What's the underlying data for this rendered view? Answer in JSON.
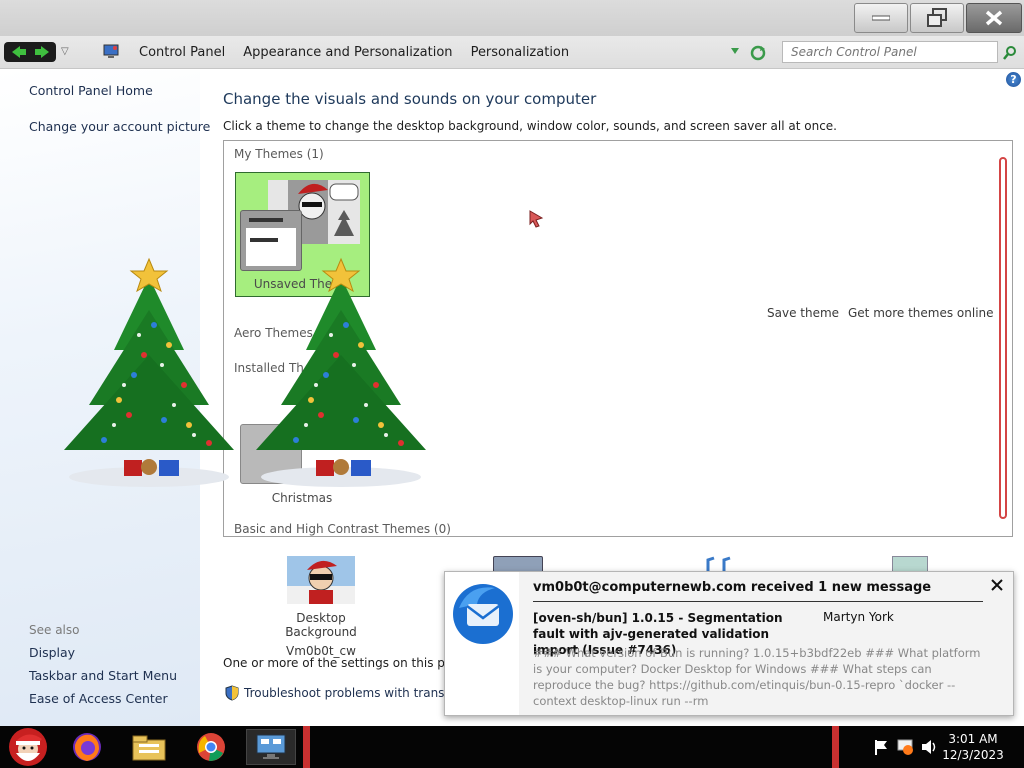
{
  "window": {
    "minimize_label": "minimize",
    "maximize_label": "restore",
    "close_label": "close"
  },
  "address": {
    "crumbs": [
      "Control Panel",
      "Appearance and Personalization",
      "Personalization"
    ],
    "search_placeholder": "Search Control Panel"
  },
  "sidebar": {
    "top_links": [
      "Control Panel Home",
      "Change your account picture"
    ],
    "see_also_label": "See also",
    "see_also_links": [
      "Display",
      "Taskbar and Start Menu",
      "Ease of Access Center"
    ]
  },
  "main": {
    "title": "Change the visuals and sounds on your computer",
    "subtitle": "Click a theme to change the desktop background, window color, sounds, and screen saver all at once.",
    "groups": {
      "my_themes": "My Themes (1)",
      "aero_themes": "Aero Themes",
      "installed_themes": "Installed Th",
      "basic_themes": "Basic and High Contrast Themes (0)"
    },
    "unsaved_theme_label": "Unsaved Theme",
    "christmas_label": "Christmas",
    "save_theme": "Save theme",
    "get_more_themes": "Get more themes online",
    "desktop_background_label": "Desktop Background",
    "desktop_background_value": "Vm0b0t_cw",
    "bottom_note": "One or more of the settings on this page h",
    "troubleshoot_link": "Troubleshoot problems with transpare"
  },
  "notification": {
    "title": "vm0b0t@computernewb.com received 1 new message",
    "subject": "[oven-sh/bun] 1.0.15 - Segmentation fault with ajv-generated validation import (Issue #7436)",
    "sender": "Martyn York",
    "body": "### What version of Bun is running? 1.0.15+b3bdf22eb ### What platform is your computer? Docker Desktop for Windows ### What steps can reproduce the bug? https://github.com/etinquis/bun-0.15-repro `docker --context desktop-linux run --rm"
  },
  "taskbar": {
    "time": "3:01 AM",
    "date": "12/3/2023"
  },
  "icons": {
    "help": "?",
    "apps": [
      "santa-start-icon",
      "firefox-icon",
      "file-explorer-icon",
      "chrome-icon",
      "control-panel-icon"
    ]
  },
  "colors": {
    "selected_tile": "#a6ee7f",
    "scrollbar_accent": "#d44545",
    "taskbar": "#050505",
    "title_text": "#1e395b"
  }
}
